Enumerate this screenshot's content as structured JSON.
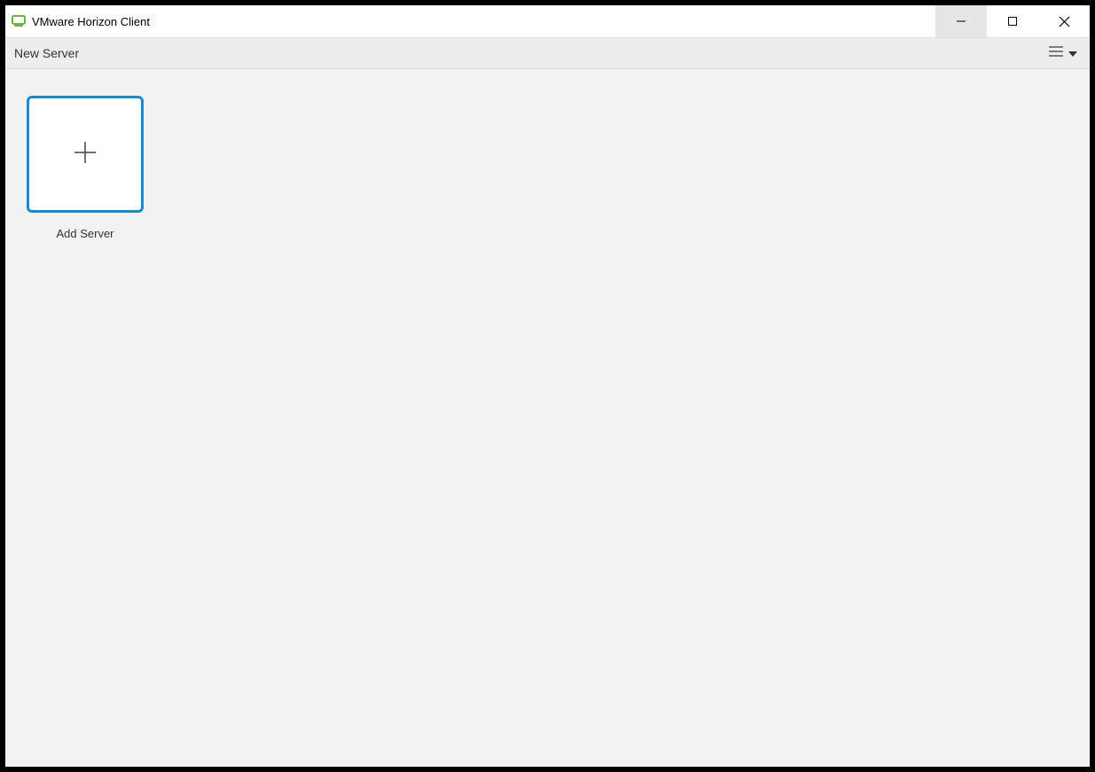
{
  "titlebar": {
    "app_title": "VMware Horizon Client",
    "app_icon_name": "vmware-horizon-icon"
  },
  "toolbar": {
    "new_server_label": "New Server",
    "menu_icon_name": "hamburger-menu"
  },
  "content": {
    "tiles": [
      {
        "label": "Add Server",
        "icon_name": "plus-icon"
      }
    ]
  },
  "colors": {
    "tile_border": "#1a8bc9",
    "toolbar_bg": "#ededed",
    "content_bg": "#f2f2f2",
    "icon_green": "#6db33f"
  }
}
